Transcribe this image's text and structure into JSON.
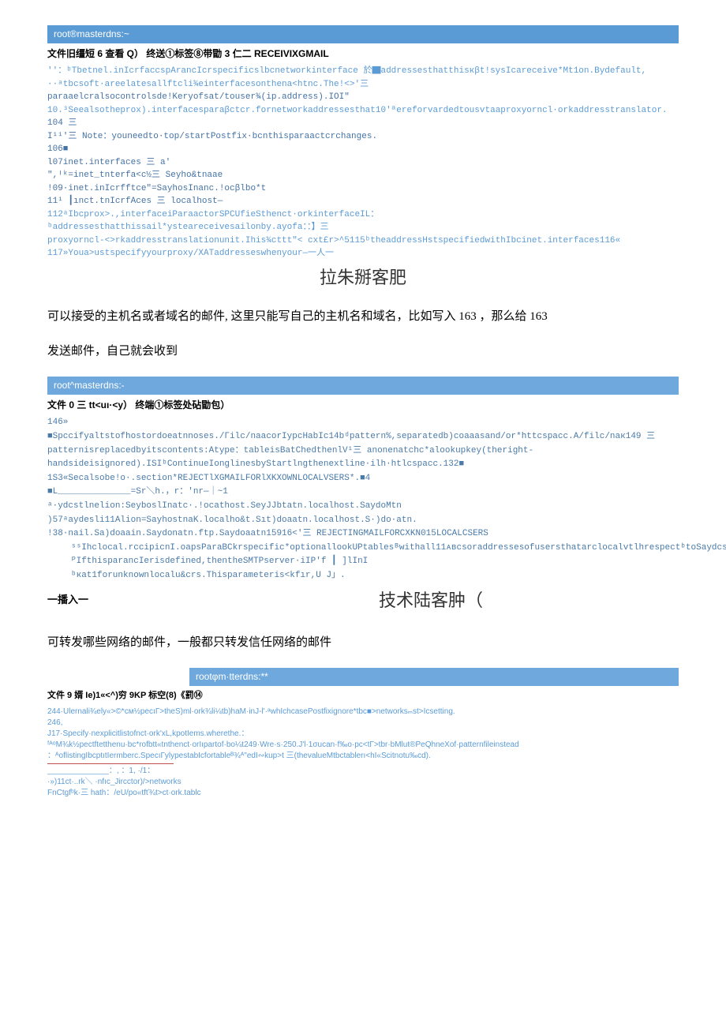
{
  "block1": {
    "title": "root®masterdns:~",
    "menubar": "文件旧缰短 6 查看 Q）  终送①标签⑧带勖 3 仁二 RECEIVIXGMAIL",
    "lines": [
      "''：ᵇTbetnel.inIcrfaccspArancIcrspecificslbcnetworkinterface 於▇addressesthatthisкβt!sysIcareceive*Mt1on.Bydefault,",
      "··ᵃtbcsoft·areelatesallftcli¾einterfacesonthena<htnc.The!<>'三",
      "paraaelcralsocontrolsde!Keryofsat/touser¾(ip.address).IOI\"",
      "10.³Seealsotheprox).interfacesparaβctcr.fornetworkaddressesthat10'ªereforvardedtousvtaaproxyorncl·orkaddresstranslator.",
      "104 三",
      "I¹¹'三 Note：youneedto·top/startPostfix·bcnthisparaactcrchanges.",
      "106■",
      "l07inet.interfaces 三 a'",
      "\",ᴵᵏ=inet_tnterfa<c½三 Seyho&tnaae",
      "!09·inet.inIcrfftce\"=SayhosInanc.!ocβlbo*t",
      "11¹ ┃ınct.tnIcrfAces 三 localhost—",
      "112ᵃIbcprox>.,interfaceiParaactorSPCUfieSthenct·orkinterfaceIL：",
      "ᵇaddressesthatthissail*ysteareceivesailonby.ayofa：：】三",
      "proxyorncl-<>rkaddresstranslationunit.Ihis¾cttt\"< cxt£r>^5115ᵇtheaddressHstspecifiedwithIbcinet.interfaces116«",
      "117»Youa>ustspecifyyourproxy/XATaddresseswhenyour—一人一"
    ],
    "watermark": "拉朱掰客肥"
  },
  "para1": "可以接受的主机名或者域名的邮件, 这里只能写自己的主机名和域名，比如写入 163   ，那么给 163",
  "para2": "发送邮件，自己就会收到",
  "block2": {
    "title": "root^masterdns:-",
    "menubar": "文件 0 三 tt<uı·<y）   终端①标签处砧勖包）",
    "lines": [
      "146»",
      "■Spccifyaltstofhostordoeatnnoses./Гilс/naacorIypcHabIc14bᵈpattern%,separatedb)coaaasand/or*httcspacc.A/filc/naк149 三 patternisreplacedbyitscontents:Atype：tableisBatChedthenlV¹三 anonenatchc*alookupkey(theright-handsideisignored).ISIᵇContinueIonglinesbyStartlngthenextline·ilh·htlcspacc.132■",
      "1S3«Secalsobe!o·.section*REJECTlXGMAILFORlXKXOWNLOCALVSERS*.■4",
      "",
      "■L______________=Sr＼h.，r：'nr—｜~1",
      "ᵃ·ydcstlnelion:SeyboslInatc·.!ocathost.SeyJJbtatn.localhost.SaydoMtn",
      ")57ᵃaydesli11Alion=SayhostnaK.localho&t.Sıt)doaatn.localhost.S·)do·atn.",
      "!38·nail.Sa)doaain.Saydonatn.ftp.Saydoaatn15916<'三 REJECTINGMAILFORСXKN015LOCALСSERS",
      "",
      "ˢˢIhclocal.rccipicnI.oapsParaBCkrspecific*optionallookUPtablesᴮwithall11ᴀʙᴄsoraddressesofusersthatarclocalvtlhrespectᵇtoSaydcstinalion.Sinet.interf·ccsorSprox>_inIcrfaces.",
      "",
      "ᴾIfthisparancIerisdefined,thentheSMTPserver·iIP'f ┃ ]lInI",
      "ᵇкat1forunknownlocalu&crs.Thisparameteris<kfır,U                                                                    J」."
    ],
    "insert": "一播入一",
    "watermark": "技术陆客肿（"
  },
  "para3": "可转发哪些网络的邮件，一般都只转发信任网络的邮件",
  "block3": {
    "title": "rootφm·tterdns:**",
    "menubar": "文件 9 婿 Ie)1«<^)穷 9KP 标空(8)《罰⑭",
    "lines": [
      "244·Ulernali¾ely«>©*ᴄᴍ½pecıГ>theS)ml·ork¾li¼tb)haM·inJ-l'·ᵃwhIchcasePostfixignore*tbc■>networksₘst>Icsetting.",
      "246,",
      "J17·Specify·nexplicitlistofnct·ork'xL,kpotIems.wherethe.：ᶠᴬᵒM¾k½pectftetthenu·bc*rofbtt«tnthenct·orIıpartof·bo¼t249·Wre·s·250.J'l·1σucan·f‰o·pc<tГ>tbr·bMlut®PeQhneXof·patternfileinstead",
      "：ᴬoflistingIbcptıtIermberc.SpecıГylypestabIcfortableᴮ¾ᴬ\"edI∾kup>t 三(thevalueMtbctablerı<hI«Scitnotu‰cd).",
      "",
      "______________：, ：1,  ·/1：",
      "·»)11ct·..rk＼     ·nfıc_Jircctor)/>networks",
      "FnCtgfᵇk·三 hath：/eU/po«tfť¾t>ct·ork.tablc"
    ]
  }
}
